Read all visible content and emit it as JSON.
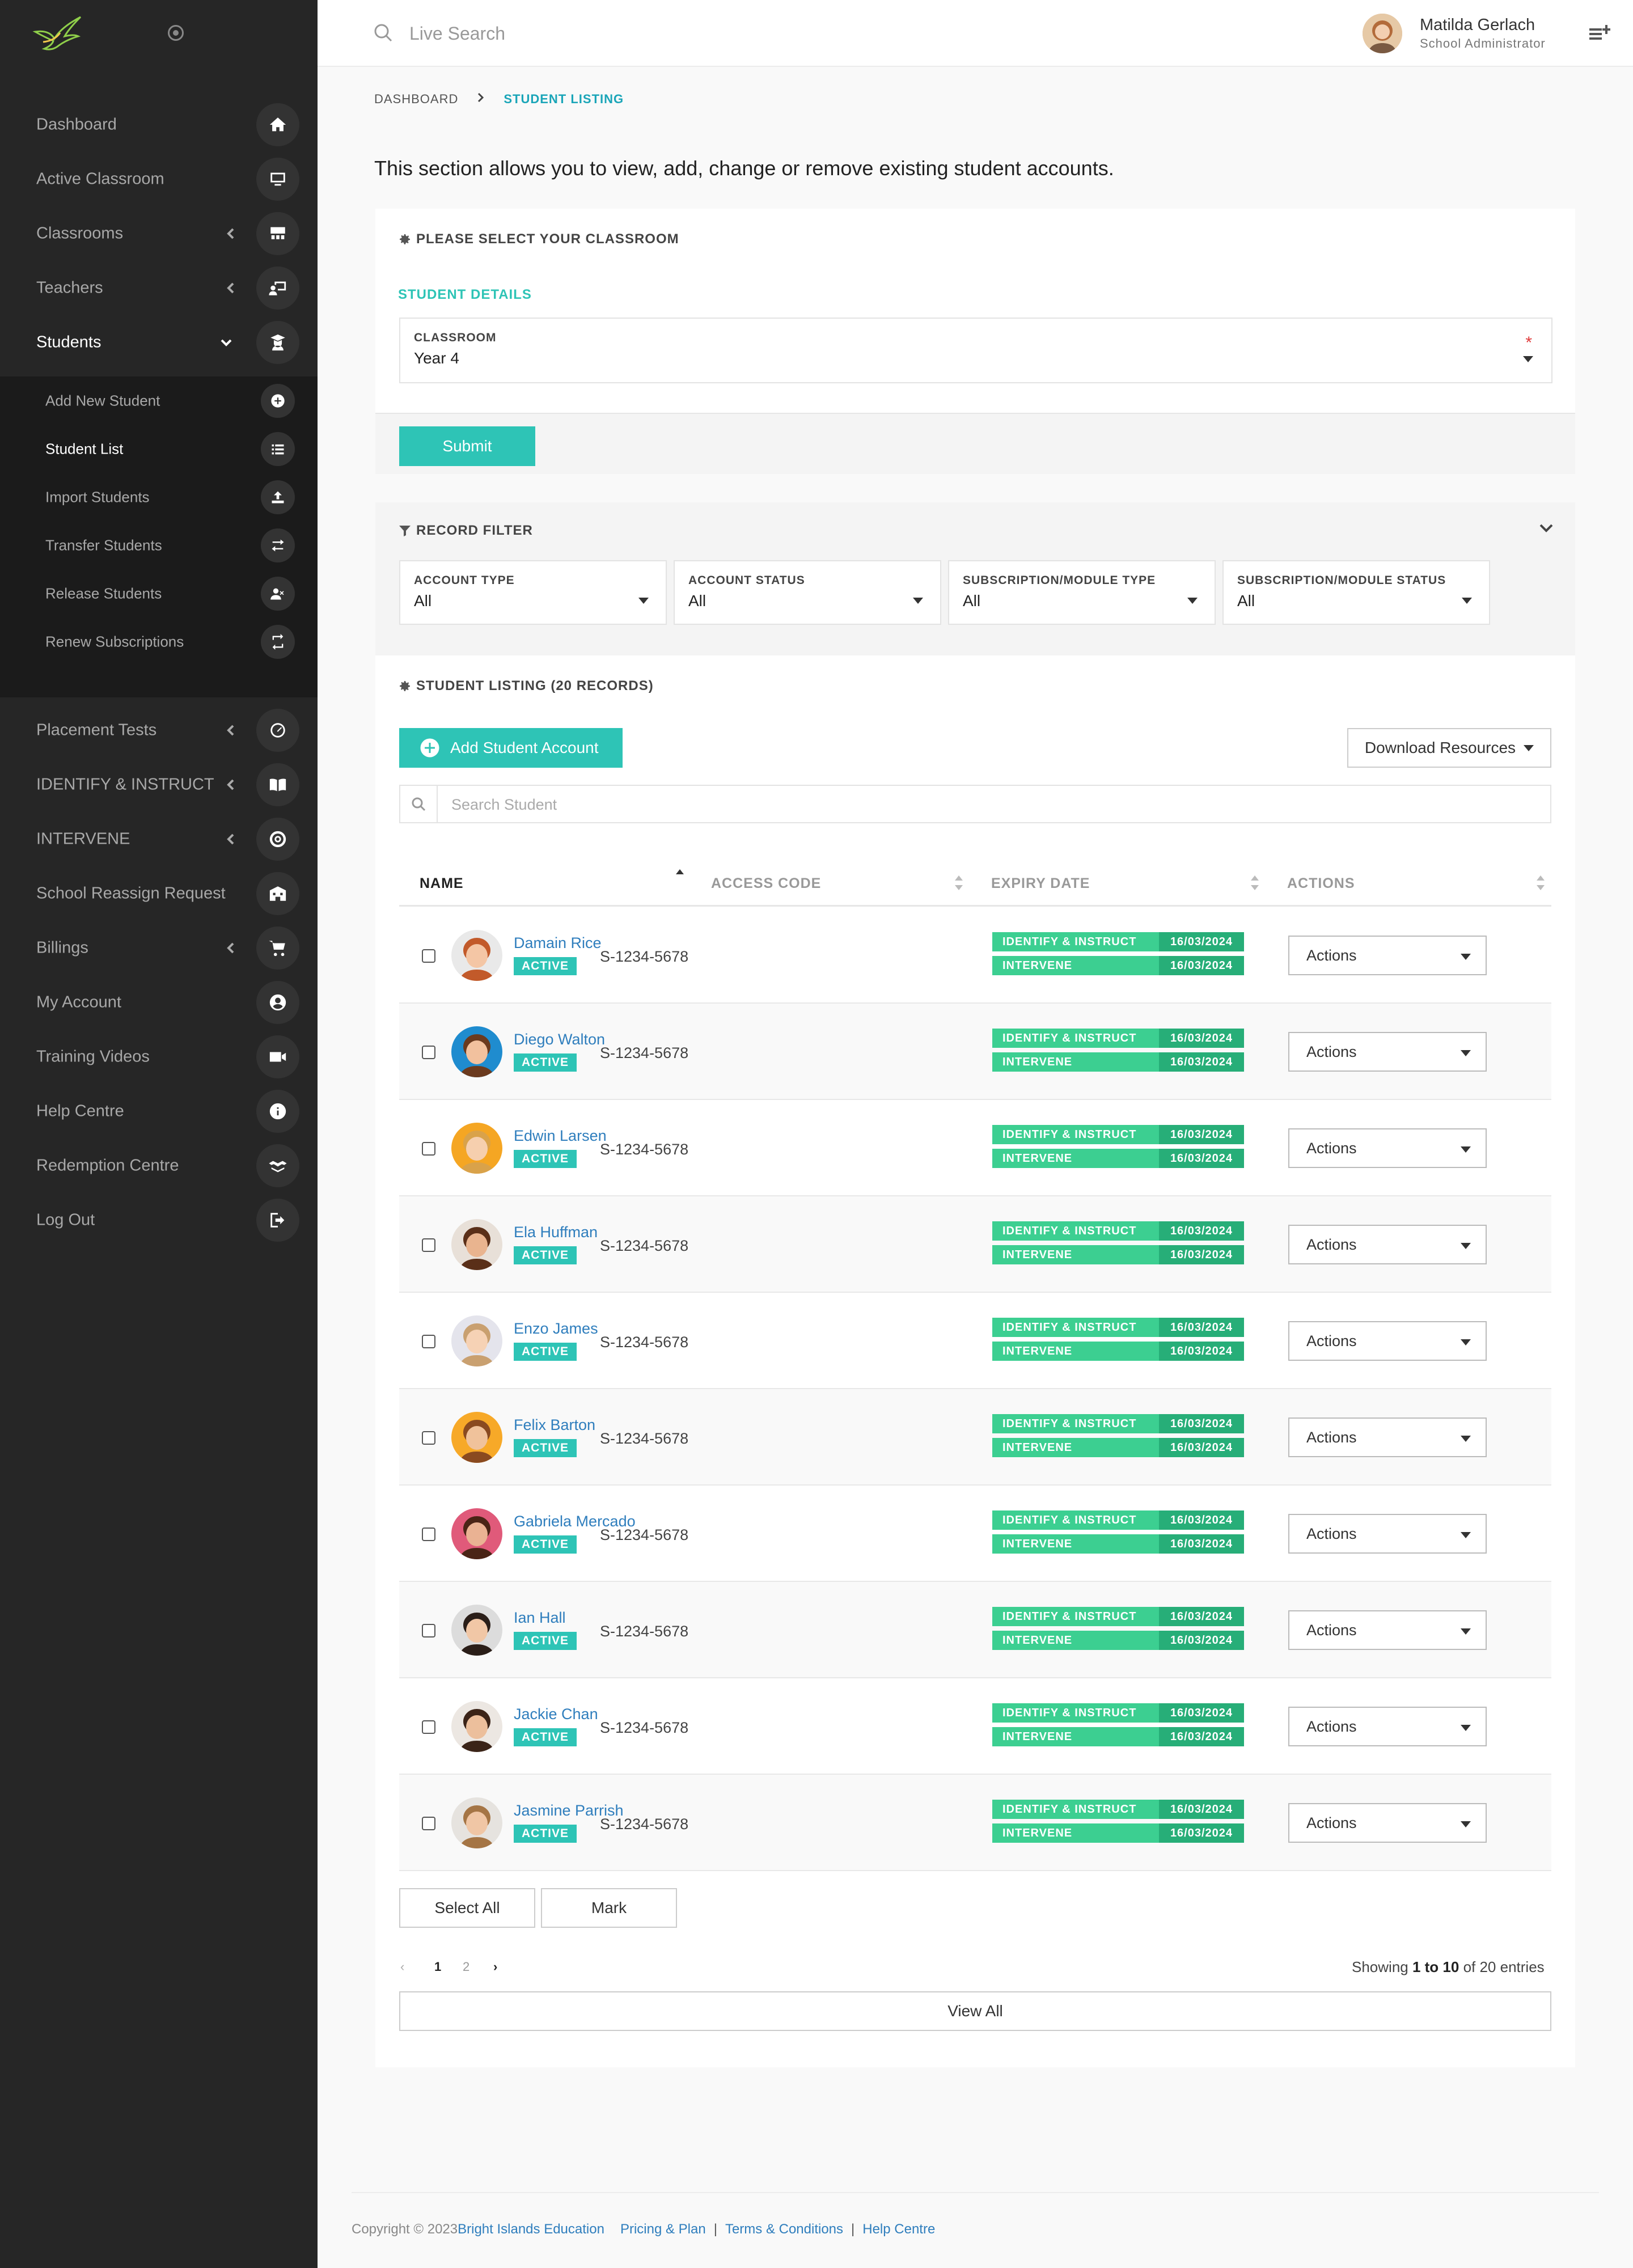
{
  "sidebar": {
    "items": [
      {
        "label": "Dashboard",
        "icon": "home-icon"
      },
      {
        "label": "Active Classroom",
        "icon": "monitor-icon"
      },
      {
        "label": "Classrooms",
        "icon": "classroom-icon"
      },
      {
        "label": "Teachers",
        "icon": "teacher-icon"
      },
      {
        "label": "Students",
        "icon": "student-icon"
      },
      {
        "label": "Placement Tests",
        "icon": "gauge-icon"
      },
      {
        "label": "IDENTIFY & INSTRUCT",
        "icon": "book-icon"
      },
      {
        "label": "INTERVENE",
        "icon": "target-icon"
      },
      {
        "label": "School Reassign Request",
        "icon": "school-icon"
      },
      {
        "label": "Billings",
        "icon": "cart-icon"
      },
      {
        "label": "My Account",
        "icon": "user-circle-icon"
      },
      {
        "label": "Training Videos",
        "icon": "video-icon"
      },
      {
        "label": "Help Centre",
        "icon": "info-icon"
      },
      {
        "label": "Redemption Centre",
        "icon": "handshake-icon"
      },
      {
        "label": "Log Out",
        "icon": "logout-icon"
      }
    ],
    "student_sub": [
      {
        "label": "Add New Student",
        "icon": "plus-circle-icon"
      },
      {
        "label": "Student List",
        "icon": "list-icon"
      },
      {
        "label": "Import Students",
        "icon": "upload-icon"
      },
      {
        "label": "Transfer Students",
        "icon": "transfer-icon"
      },
      {
        "label": "Release Students",
        "icon": "user-remove-icon"
      },
      {
        "label": "Renew Subscriptions",
        "icon": "renew-icon"
      }
    ]
  },
  "topbar": {
    "search_placeholder": "Live Search",
    "user_name": "Matilda Gerlach",
    "user_role": "School Administrator"
  },
  "breadcrumb": {
    "parent": "DASHBOARD",
    "current": "STUDENT LISTING"
  },
  "intro": "This section allows you to view, add, change or remove existing student accounts.",
  "classroom_card": {
    "title": "PLEASE SELECT YOUR CLASSROOM",
    "section": "STUDENT DETAILS",
    "field_label": "CLASSROOM",
    "field_value": "Year 4",
    "required_mark": "*",
    "submit": "Submit"
  },
  "filter": {
    "title": "RECORD FILTER",
    "fields": [
      {
        "label": "ACCOUNT TYPE",
        "value": "All"
      },
      {
        "label": "ACCOUNT STATUS",
        "value": "All"
      },
      {
        "label": "SUBSCRIPTION/MODULE TYPE",
        "value": "All"
      },
      {
        "label": "SUBSCRIPTION/MODULE STATUS",
        "value": "All"
      }
    ]
  },
  "listing": {
    "title": "STUDENT LISTING (20 RECORDS)",
    "add_button": "Add Student Account",
    "download_button": "Download Resources",
    "search_placeholder": "Search Student",
    "columns": [
      "NAME",
      "ACCESS CODE",
      "EXPIRY DATE",
      "ACTIONS"
    ],
    "rows": [
      {
        "name": "Damain Rice",
        "status": "ACTIVE",
        "code": "S-1234-5678",
        "sub1": "IDENTIFY & INSTRUCT",
        "date1": "16/03/2024",
        "sub2": "INTERVENE",
        "date2": "16/03/2024",
        "action": "Actions",
        "bg": "#e9e9e9",
        "skin": "#f4c6a5",
        "hair": "#c25a2a"
      },
      {
        "name": "Diego Walton",
        "status": "ACTIVE",
        "code": "S-1234-5678",
        "sub1": "IDENTIFY & INSTRUCT",
        "date1": "16/03/2024",
        "sub2": "INTERVENE",
        "date2": "16/03/2024",
        "action": "Actions",
        "bg": "#1f8ccf",
        "skin": "#f2c19e",
        "hair": "#6b3a1e"
      },
      {
        "name": "Edwin Larsen",
        "status": "ACTIVE",
        "code": "S-1234-5678",
        "sub1": "IDENTIFY & INSTRUCT",
        "date1": "16/03/2024",
        "sub2": "INTERVENE",
        "date2": "16/03/2024",
        "action": "Actions",
        "bg": "#f5a623",
        "skin": "#f6cfae",
        "hair": "#d9a24a"
      },
      {
        "name": "Ela Huffman",
        "status": "ACTIVE",
        "code": "S-1234-5678",
        "sub1": "IDENTIFY & INSTRUCT",
        "date1": "16/03/2024",
        "sub2": "INTERVENE",
        "date2": "16/03/2024",
        "action": "Actions",
        "bg": "#e8e0d8",
        "skin": "#e9b48f",
        "hair": "#5a2f18"
      },
      {
        "name": "Enzo James",
        "status": "ACTIVE",
        "code": "S-1234-5678",
        "sub1": "IDENTIFY & INSTRUCT",
        "date1": "16/03/2024",
        "sub2": "INTERVENE",
        "date2": "16/03/2024",
        "action": "Actions",
        "bg": "#e4e4ec",
        "skin": "#f6d2b5",
        "hair": "#c9a070"
      },
      {
        "name": "Felix Barton",
        "status": "ACTIVE",
        "code": "S-1234-5678",
        "sub1": "IDENTIFY & INSTRUCT",
        "date1": "16/03/2024",
        "sub2": "INTERVENE",
        "date2": "16/03/2024",
        "action": "Actions",
        "bg": "#f7a928",
        "skin": "#f0c29b",
        "hair": "#8a4a20"
      },
      {
        "name": "Gabriela Mercado",
        "status": "ACTIVE",
        "code": "S-1234-5678",
        "sub1": "IDENTIFY & INSTRUCT",
        "date1": "16/03/2024",
        "sub2": "INTERVENE",
        "date2": "16/03/2024",
        "action": "Actions",
        "bg": "#e05a7a",
        "skin": "#eab293",
        "hair": "#4a2416"
      },
      {
        "name": "Ian Hall",
        "status": "ACTIVE",
        "code": "S-1234-5678",
        "sub1": "IDENTIFY & INSTRUCT",
        "date1": "16/03/2024",
        "sub2": "INTERVENE",
        "date2": "16/03/2024",
        "action": "Actions",
        "bg": "#dcdcdc",
        "skin": "#f1c7a6",
        "hair": "#2a1e18"
      },
      {
        "name": "Jackie Chan",
        "status": "ACTIVE",
        "code": "S-1234-5678",
        "sub1": "IDENTIFY & INSTRUCT",
        "date1": "16/03/2024",
        "sub2": "INTERVENE",
        "date2": "16/03/2024",
        "action": "Actions",
        "bg": "#ece7e2",
        "skin": "#ecbf9c",
        "hair": "#3b2418"
      },
      {
        "name": "Jasmine Parrish",
        "status": "ACTIVE",
        "code": "S-1234-5678",
        "sub1": "IDENTIFY & INSTRUCT",
        "date1": "16/03/2024",
        "sub2": "INTERVENE",
        "date2": "16/03/2024",
        "action": "Actions",
        "bg": "#e6e3df",
        "skin": "#f0c6a5",
        "hair": "#a57545"
      }
    ],
    "select_all": "Select All",
    "mark": "Mark",
    "pages": [
      "1",
      "2"
    ],
    "showing": {
      "prefix": "Showing ",
      "range": "1 to 10",
      "suffix": " of 20 entries"
    },
    "view_all": "View All"
  },
  "footer": {
    "copyright": "Copyright © 2023 ",
    "company": "Bright Islands Education",
    "links": [
      "Pricing & Plan",
      "Terms & Conditions",
      "Help Centre"
    ],
    "sep": "|"
  },
  "colors": {
    "teal": "#2ec4b6",
    "green": "#3ccf91",
    "green_dark": "#27ae78",
    "sidebar": "#262626",
    "link": "#2f7ebd"
  }
}
